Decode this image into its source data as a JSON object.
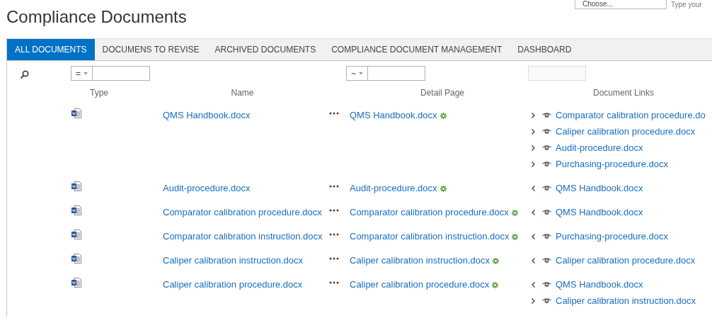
{
  "title": "Compliance Documents",
  "top_controls": {
    "dropdown": "Choose...",
    "field_placeholder": "Type your"
  },
  "tabs": [
    {
      "label": "ALL DOCUMENTS",
      "selected": true
    },
    {
      "label": "DOCUMENS TO REVISE",
      "selected": false
    },
    {
      "label": "ARCHIVED DOCUMENTS",
      "selected": false
    },
    {
      "label": "COMPLIANCE DOCUMENT MANAGEMENT",
      "selected": false
    },
    {
      "label": "DASHBOARD",
      "selected": false
    }
  ],
  "filters": {
    "name_operator": "=",
    "detail_operator": "~"
  },
  "table": {
    "columns": [
      "Type",
      "Name",
      "Detail Page",
      "Document Links"
    ],
    "rows": [
      {
        "name": "QMS Handbook.docx",
        "detail": "QMS Handbook.docx",
        "links": [
          {
            "kind": "out",
            "label": "Comparator calibration procedure.do"
          },
          {
            "kind": "out",
            "label": "Caliper calibration procedure.docx"
          },
          {
            "kind": "out",
            "label": "Audit-procedure.docx"
          },
          {
            "kind": "out",
            "label": "Purchasing-procedure.docx"
          }
        ]
      },
      {
        "name": "Audit-procedure.docx",
        "detail": "Audit-procedure.docx",
        "links": [
          {
            "kind": "in",
            "label": "QMS Handbook.docx"
          }
        ]
      },
      {
        "name": "Comparator calibration procedure.docx",
        "detail": "Comparator calibration procedure.docx",
        "links": [
          {
            "kind": "in",
            "label": "QMS Handbook.docx"
          }
        ]
      },
      {
        "name": "Comparator calibration instruction.docx",
        "detail": "Comparator calibration instruction.docx",
        "links": [
          {
            "kind": "in",
            "label": "Purchasing-procedure.docx"
          }
        ]
      },
      {
        "name": "Caliper calibration instruction.docx",
        "detail": "Caliper calibration instruction.docx",
        "links": [
          {
            "kind": "in",
            "label": "Caliper calibration procedure.docx"
          }
        ]
      },
      {
        "name": "Caliper calibration procedure.docx",
        "detail": "Caliper calibration procedure.docx",
        "links": [
          {
            "kind": "in",
            "label": "QMS Handbook.docx"
          },
          {
            "kind": "out",
            "label": "Caliper calibration instruction.docx"
          }
        ]
      }
    ]
  }
}
